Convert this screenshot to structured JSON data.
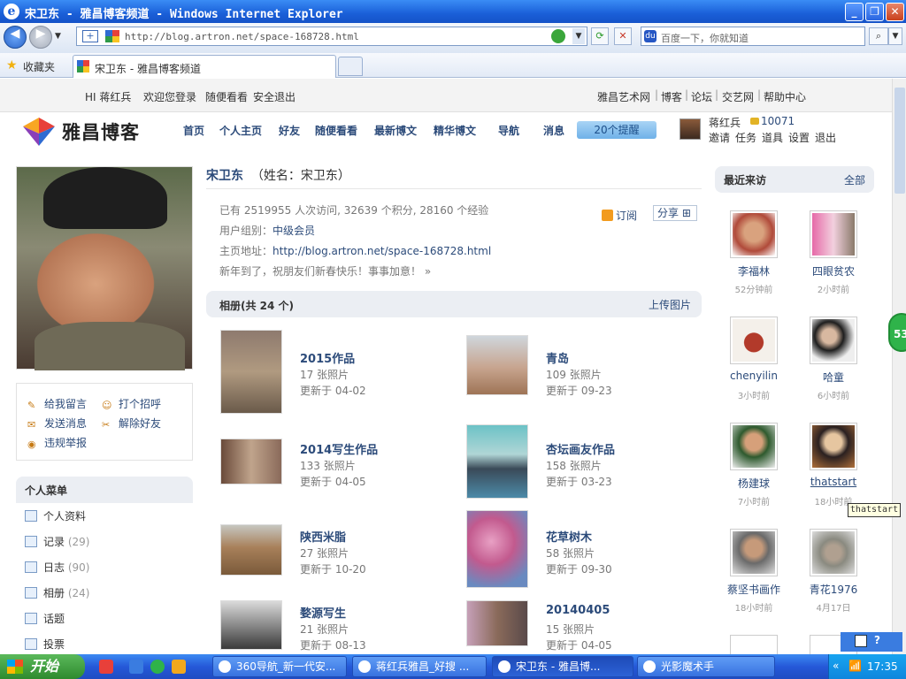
{
  "window": {
    "title": "宋卫东 - 雅昌博客频道 - Windows Internet Explorer"
  },
  "browser": {
    "url": "http://blog.artron.net/space-168728.html",
    "search_placeholder": "百度一下，你就知道",
    "favorites": "收藏夹",
    "tab_title": "宋卫东 - 雅昌博客频道"
  },
  "topstrip": {
    "greeting": "HI 蒋红兵",
    "welcome": "欢迎您登录",
    "random": "随便看看",
    "logout": "安全退出",
    "links": [
      "雅昌艺术网",
      "博客",
      "论坛",
      "交艺网",
      "帮助中心"
    ]
  },
  "site": {
    "logo": "雅昌博客",
    "nav": [
      "首页",
      "个人主页",
      "好友",
      "随便看看",
      "最新博文",
      "精华博文",
      "导航",
      "消息"
    ],
    "remind": "20个提醒",
    "user": "蒋红兵",
    "coins": "10071",
    "user_links": [
      "邀请",
      "任务",
      "道具",
      "设置",
      "退出"
    ]
  },
  "actions": [
    "给我留言",
    "打个招呼",
    "发送消息",
    "解除好友",
    "违规举报"
  ],
  "menu": {
    "title": "个人菜单",
    "items": [
      {
        "label": "个人资料",
        "count": ""
      },
      {
        "label": "记录",
        "count": "(29)"
      },
      {
        "label": "日志",
        "count": "(90)"
      },
      {
        "label": "相册",
        "count": "(24)"
      },
      {
        "label": "话题",
        "count": ""
      },
      {
        "label": "投票",
        "count": ""
      }
    ]
  },
  "profile": {
    "name": "宋卫东",
    "realname": "（姓名：宋卫东）",
    "stats": "已有 2519955 人次访问, 32639 个积分, 28160 个经验",
    "group_label": "用户组别：",
    "group": "中级会员",
    "home_label": "主页地址：",
    "home": "http://blog.artron.net/space-168728.html",
    "motto": "新年到了，祝朋友们新春快乐！事事加意！ »",
    "subscribe": "订阅",
    "share": "分享"
  },
  "albums": {
    "title": "相册(共 24 个)",
    "upload": "上传图片",
    "items": [
      {
        "name": "2015作品",
        "count": "17 张照片",
        "updated": "更新于 04-02"
      },
      {
        "name": "青岛",
        "count": "109 张照片",
        "updated": "更新于 09-23"
      },
      {
        "name": "2014写生作品",
        "count": "133 张照片",
        "updated": "更新于 04-05"
      },
      {
        "name": "杏坛画友作品",
        "count": "158 张照片",
        "updated": "更新于 03-23"
      },
      {
        "name": "陕西米脂",
        "count": "27 张照片",
        "updated": "更新于 10-20"
      },
      {
        "name": "花草树木",
        "count": "58 张照片",
        "updated": "更新于 09-30"
      },
      {
        "name": "婺源写生",
        "count": "21 张照片",
        "updated": "更新于 08-13"
      },
      {
        "name": "20140405",
        "count": "15 张照片",
        "updated": "更新于 04-05"
      }
    ]
  },
  "visitors": {
    "title": "最近来访",
    "all": "全部",
    "items": [
      {
        "name": "李福林",
        "time": "52分钟前"
      },
      {
        "name": "四眼贫农",
        "time": "2小时前"
      },
      {
        "name": "chenyilin",
        "time": "3小时前"
      },
      {
        "name": "哈童",
        "time": "6小时前"
      },
      {
        "name": "杨建球",
        "time": "7小时前"
      },
      {
        "name": "thatstart",
        "time": "18小时前"
      },
      {
        "name": "蔡坚书画作",
        "time": "18小时前"
      },
      {
        "name": "青花1976",
        "time": "4月17日"
      }
    ]
  },
  "tooltip": "thatstart",
  "badge": "53",
  "taskbar": {
    "start": "开始",
    "tasks": [
      "360导航_新一代安...",
      "蒋红兵雅昌_好搜 ...",
      "宋卫东 - 雅昌博...",
      "光影魔术手"
    ],
    "clock": "17:35"
  }
}
